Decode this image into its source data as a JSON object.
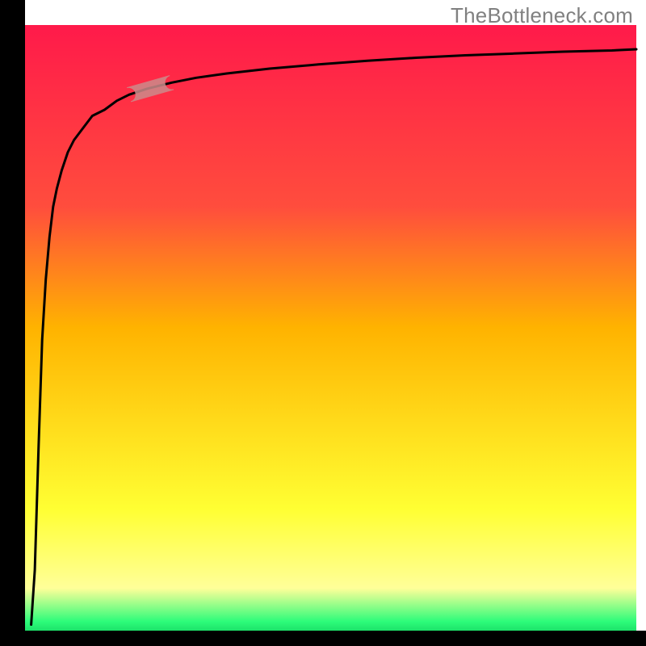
{
  "watermark": "TheBottleneck.com",
  "colors": {
    "top": "#ff1a4a",
    "mid": "#ffb300",
    "yellow": "#ffff33",
    "paleyellow": "#ffff99",
    "green": "#2dfc7a",
    "axis": "#000000",
    "curve": "#000000",
    "capsule_fill": "#cc8b8b",
    "capsule_stroke": "#cc8b8b"
  },
  "chart_data": {
    "type": "line",
    "title": "",
    "xlabel": "",
    "ylabel": "",
    "xlim": [
      0,
      100
    ],
    "ylim": [
      0,
      100
    ],
    "x": [
      1.0,
      1.6,
      2.2,
      2.8,
      3.4,
      4.0,
      4.6,
      5.2,
      6.0,
      7.0,
      8.0,
      9.5,
      11,
      13,
      15,
      17,
      20,
      24,
      28,
      33,
      40,
      48,
      56,
      64,
      72,
      80,
      88,
      96,
      100
    ],
    "values": [
      1,
      10,
      30,
      48,
      58,
      65,
      70,
      73,
      76,
      79,
      81,
      83,
      85,
      86,
      87.5,
      88.5,
      89.5,
      90.5,
      91.3,
      92.0,
      92.8,
      93.5,
      94.1,
      94.6,
      95.0,
      95.3,
      95.6,
      95.8,
      96.0
    ],
    "capsule_marker": {
      "x_start": 17,
      "x_end": 24
    }
  }
}
